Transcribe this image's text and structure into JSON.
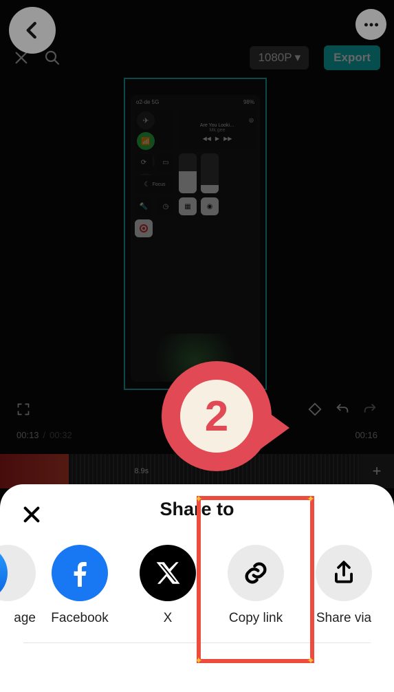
{
  "nav": {
    "back_aria": "Back",
    "more_aria": "More options"
  },
  "editor": {
    "close_aria": "Close",
    "search_aria": "Search",
    "resolution": "1080P",
    "export_label": "Export",
    "phone": {
      "carrier": "o2-de 5G",
      "battery": "98%",
      "music_title": "Are You Looki…",
      "music_artist": "Mk.gee",
      "focus_label": "Focus",
      "brightness_pct": 55,
      "volume_pct": 20
    },
    "time_current": "00:13",
    "time_total": "00:32",
    "time_right": "00:16",
    "timeline_mid_label": "8.9s"
  },
  "step": {
    "number": "2"
  },
  "sheet": {
    "title": "Share to",
    "close_aria": "Close",
    "items": [
      {
        "label": "age",
        "icon": "message-icon"
      },
      {
        "label": "Facebook",
        "icon": "facebook-icon"
      },
      {
        "label": "X",
        "icon": "x-icon"
      },
      {
        "label": "Copy link",
        "icon": "link-icon"
      },
      {
        "label": "Share via",
        "icon": "share-icon"
      }
    ]
  }
}
